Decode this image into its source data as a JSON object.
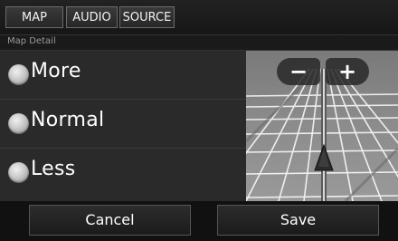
{
  "tabs": [
    {
      "label": "MAP"
    },
    {
      "label": "AUDIO"
    },
    {
      "label": "SOURCE"
    }
  ],
  "section": {
    "title": "Map Detail"
  },
  "options": [
    {
      "label": "More",
      "selected": false
    },
    {
      "label": "Normal",
      "selected": false
    },
    {
      "label": "Less",
      "selected": false
    }
  ],
  "map": {
    "zoom_out_icon": "minus-icon",
    "zoom_in_icon": "plus-icon",
    "zoom_out_label": "−",
    "zoom_in_label": "+",
    "vehicle_icon": "vehicle-arrow-icon"
  },
  "actions": {
    "cancel_label": "Cancel",
    "save_label": "Save"
  },
  "colors": {
    "background": "#0e0e0e",
    "panel": "#2a2a2a",
    "map_background": "#8d8d8d",
    "map_roads": "#ffffff",
    "vehicle": "#2a2a2a"
  }
}
